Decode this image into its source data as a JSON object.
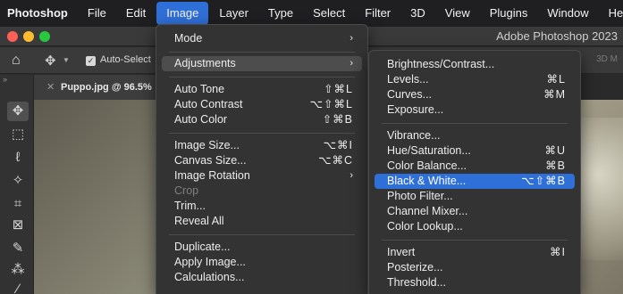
{
  "menubar": {
    "items": [
      "Photoshop",
      "File",
      "Edit",
      "Image",
      "Layer",
      "Type",
      "Select",
      "Filter",
      "3D",
      "View",
      "Plugins",
      "Window",
      "Help"
    ],
    "active": "Image"
  },
  "window": {
    "title": "Adobe Photoshop 2023"
  },
  "options_bar": {
    "auto_select_label": "Auto-Select",
    "mode_3d": "3D M"
  },
  "document": {
    "tab_title": "Puppo.jpg @ 96.5%"
  },
  "image_menu": {
    "mode": "Mode",
    "adjustments": "Adjustments",
    "auto_tone": {
      "label": "Auto Tone",
      "shortcut": "⇧⌘L"
    },
    "auto_contrast": {
      "label": "Auto Contrast",
      "shortcut": "⌥⇧⌘L"
    },
    "auto_color": {
      "label": "Auto Color",
      "shortcut": "⇧⌘B"
    },
    "image_size": {
      "label": "Image Size...",
      "shortcut": "⌥⌘I"
    },
    "canvas_size": {
      "label": "Canvas Size...",
      "shortcut": "⌥⌘C"
    },
    "image_rotation": "Image Rotation",
    "crop": "Crop",
    "trim": "Trim...",
    "reveal_all": "Reveal All",
    "duplicate": "Duplicate...",
    "apply_image": "Apply Image...",
    "calculations": "Calculations..."
  },
  "adjustments_menu": {
    "brightness_contrast": {
      "label": "Brightness/Contrast..."
    },
    "levels": {
      "label": "Levels...",
      "shortcut": "⌘L"
    },
    "curves": {
      "label": "Curves...",
      "shortcut": "⌘M"
    },
    "exposure": {
      "label": "Exposure..."
    },
    "vibrance": {
      "label": "Vibrance..."
    },
    "hue_saturation": {
      "label": "Hue/Saturation...",
      "shortcut": "⌘U"
    },
    "color_balance": {
      "label": "Color Balance...",
      "shortcut": "⌘B"
    },
    "black_white": {
      "label": "Black & White...",
      "shortcut": "⌥⇧⌘B"
    },
    "photo_filter": {
      "label": "Photo Filter..."
    },
    "channel_mixer": {
      "label": "Channel Mixer..."
    },
    "color_lookup": {
      "label": "Color Lookup..."
    },
    "invert": {
      "label": "Invert",
      "shortcut": "⌘I"
    },
    "posterize": {
      "label": "Posterize..."
    },
    "threshold": {
      "label": "Threshold..."
    }
  },
  "colors": {
    "highlight": "#2f6fd8",
    "menu_bg": "#333333"
  }
}
